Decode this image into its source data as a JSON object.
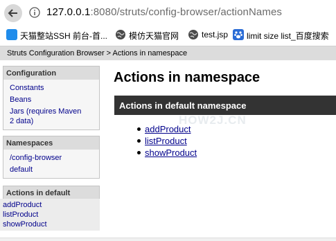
{
  "browser": {
    "url_host": "127.0.0.1",
    "url_rest": ":8080/struts/config-browser/actionNames",
    "bookmarks": [
      {
        "label": "天猫整站SSH 前台-首...",
        "icon": "bookmark-blue-icon"
      },
      {
        "label": "模仿天猫官网",
        "icon": "globe-icon"
      },
      {
        "label": "test.jsp",
        "icon": "globe-icon"
      },
      {
        "label": "limit size list_百度搜索",
        "icon": "baidu-paw-icon"
      }
    ]
  },
  "header": {
    "breadcrumb": "Struts Configuration Browser > Actions in namespace"
  },
  "sidebar": {
    "configuration": {
      "title": "Configuration",
      "links": [
        "Constants",
        "Beans",
        "Jars (requires Maven",
        "2 data)"
      ]
    },
    "namespaces": {
      "title": "Namespaces",
      "links": [
        "/config-browser",
        "default"
      ]
    },
    "actions_in_default": {
      "title": "Actions in default",
      "links": [
        "addProduct",
        "listProduct",
        "showProduct"
      ]
    }
  },
  "main": {
    "title": "Actions in namespace",
    "section_title": "Actions in default namespace",
    "actions": [
      "addProduct",
      "listProduct",
      "showProduct"
    ],
    "watermark": "HOW2J.CN"
  }
}
